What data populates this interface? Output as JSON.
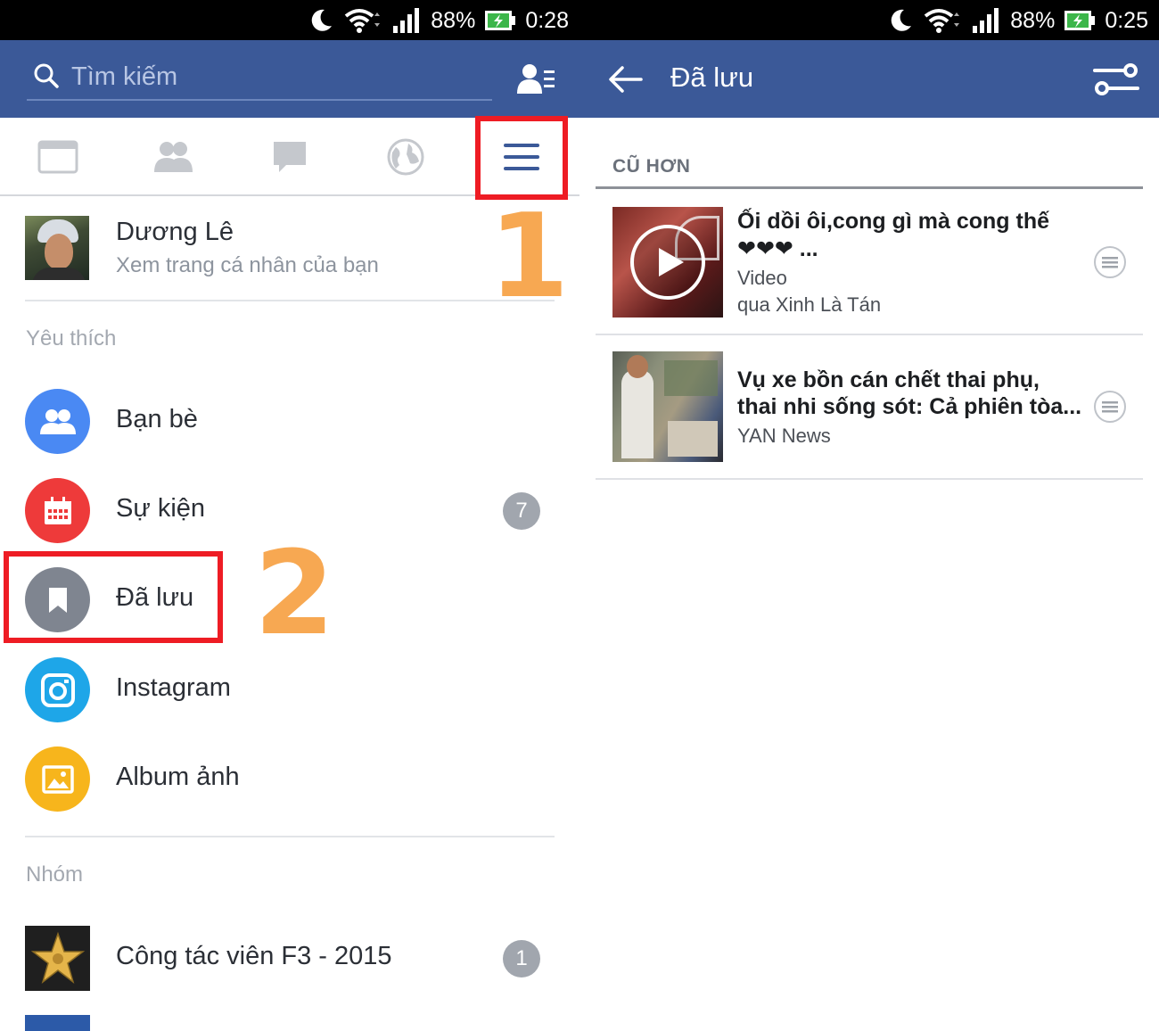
{
  "left": {
    "status": {
      "battery_pct": "88%",
      "time": "0:28"
    },
    "search": {
      "placeholder": "Tìm kiếm"
    },
    "profile": {
      "name": "Dương Lê",
      "subtitle": "Xem trang cá nhân của bạn"
    },
    "sections": {
      "favorites": "Yêu thích",
      "groups": "Nhóm"
    },
    "menu": [
      {
        "label": "Bạn bè",
        "icon": "friends-icon",
        "color": "#4a89f3"
      },
      {
        "label": "Sự kiện",
        "icon": "calendar-icon",
        "color": "#ee3a3a",
        "badge": "7"
      },
      {
        "label": "Đã lưu",
        "icon": "bookmark-icon",
        "color": "#7f8590"
      },
      {
        "label": "Instagram",
        "icon": "instagram-icon",
        "color": "#1ea6e8"
      },
      {
        "label": "Album ảnh",
        "icon": "photo-icon",
        "color": "#f7b51c"
      }
    ],
    "groups": [
      {
        "label": "Công tác viên F3 - 2015",
        "badge": "1"
      }
    ],
    "annotations": {
      "step1": "1",
      "step2": "2"
    }
  },
  "right": {
    "status": {
      "battery_pct": "88%",
      "time": "0:25"
    },
    "title": "Đã lưu",
    "section": "CŨ HƠN",
    "items": [
      {
        "title_line1": "Ối dồi ôi,cong gì mà cong thế",
        "title_line2": "❤❤❤ ...",
        "type": "Video",
        "source": "qua Xinh Là Tán"
      },
      {
        "title_line1": "Vụ xe bồn cán chết thai phụ,",
        "title_line2": "thai nhi sống sót: Cả phiên tòa...",
        "source": "YAN News"
      }
    ]
  },
  "colors": {
    "appbar": "#3b5998",
    "highlight": "#ee1c24",
    "step_number": "#f7a852"
  }
}
